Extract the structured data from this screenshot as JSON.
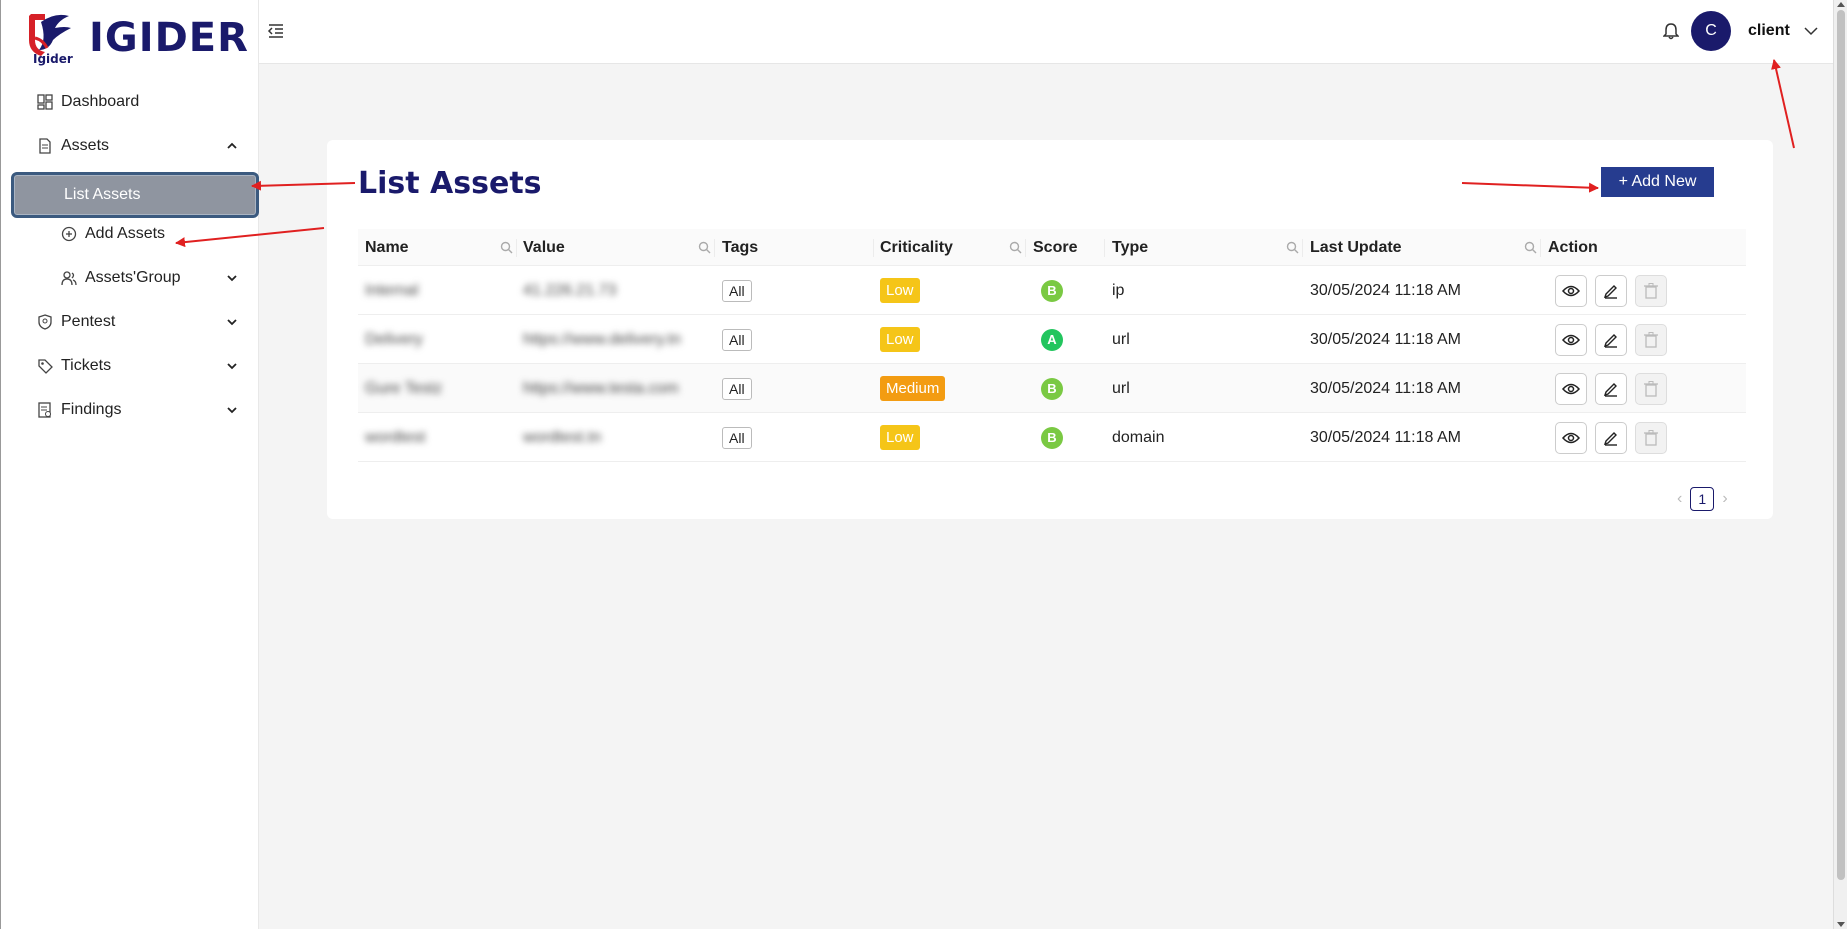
{
  "brand": {
    "name": "IGIDER",
    "logo_caption": "Igider",
    "color": "#1a1a6b"
  },
  "sidebar": {
    "items": [
      {
        "label": "Dashboard",
        "icon": "dashboard-icon"
      },
      {
        "label": "Assets",
        "icon": "file-icon",
        "expanded": true
      },
      {
        "label": "List Assets",
        "active": true
      },
      {
        "label": "Add Assets",
        "icon": "plus-circle-icon"
      },
      {
        "label": "Assets'Group",
        "icon": "users-icon"
      },
      {
        "label": "Pentest",
        "icon": "shield-icon"
      },
      {
        "label": "Tickets",
        "icon": "tag-icon"
      },
      {
        "label": "Findings",
        "icon": "report-icon"
      }
    ]
  },
  "topbar": {
    "user_initial": "C",
    "username": "client"
  },
  "page": {
    "title": "List Assets",
    "add_button": "+ Add New"
  },
  "table": {
    "columns": [
      "Name",
      "Value",
      "Tags",
      "Criticality",
      "Score",
      "Type",
      "Last Update",
      "Action"
    ],
    "rows": [
      {
        "name": "Internal",
        "value": "41.226.21.73",
        "tag": "All",
        "criticality": "Low",
        "score": "B",
        "type": "ip",
        "last_update": "30/05/2024 11:18 AM"
      },
      {
        "name": "Delivery",
        "value": "https://www.delivery.tn",
        "tag": "All",
        "criticality": "Low",
        "score": "A",
        "type": "url",
        "last_update": "30/05/2024 11:18 AM"
      },
      {
        "name": "Gure Testz",
        "value": "https://www.testa.com",
        "tag": "All",
        "criticality": "Medium",
        "score": "B",
        "type": "url",
        "last_update": "30/05/2024 11:18 AM"
      },
      {
        "name": "wordtest",
        "value": "wordtest.tn",
        "tag": "All",
        "criticality": "Low",
        "score": "B",
        "type": "domain",
        "last_update": "30/05/2024 11:18 AM"
      }
    ]
  },
  "pagination": {
    "current": "1"
  },
  "colors": {
    "score_a": "#22c55e",
    "score_b": "#7ac943",
    "crit_low": "#f5c518",
    "crit_medium": "#f39c12",
    "primary_button": "#263c8f",
    "annotation_arrow": "#e02020"
  }
}
